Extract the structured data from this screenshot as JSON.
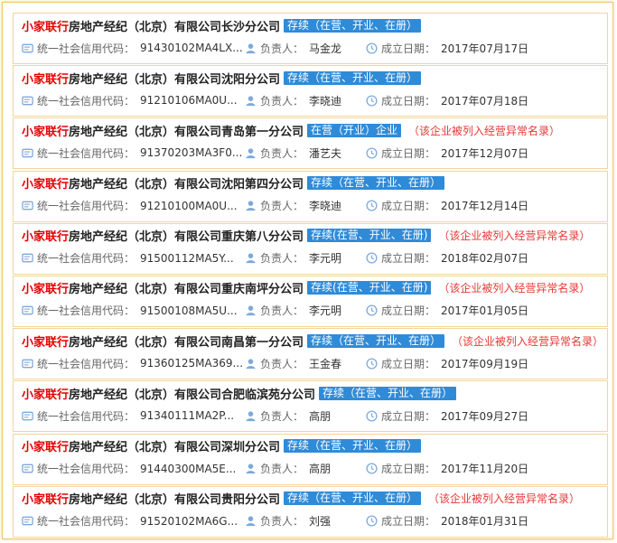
{
  "colors": {
    "brand": "#e60000",
    "status_bg": "#2f8bd8",
    "warning": "#e53935",
    "border": "#f1d59c",
    "icon": "#7fa9db"
  },
  "labels": {
    "credit": "统一社会信用代码：",
    "person": "负责人：",
    "date": "成立日期："
  },
  "companies": [
    {
      "brand": "小家联行",
      "name": "房地产经纪（北京）有限公司长沙分公司",
      "status": "存续（在营、开业、在册）",
      "abnormal": "",
      "credit_code": "91430102MA4LX...",
      "person": "马金龙",
      "date": "2017年07月17日"
    },
    {
      "brand": "小家联行",
      "name": "房地产经纪（北京）有限公司沈阳分公司",
      "status": "存续（在营、开业、在册）",
      "abnormal": "",
      "credit_code": "91210106MA0U...",
      "person": "李晓迪",
      "date": "2017年07月18日"
    },
    {
      "brand": "小家联行",
      "name": "房地产经纪（北京）有限公司青岛第一分公司",
      "status": "在营（开业）企业",
      "abnormal": "（该企业被列入经营异常名录）",
      "credit_code": "91370203MA3F0...",
      "person": "潘艺夫",
      "date": "2017年12月07日"
    },
    {
      "brand": "小家联行",
      "name": "房地产经纪（北京）有限公司沈阳第四分公司",
      "status": "存续（在营、开业、在册）",
      "abnormal": "",
      "credit_code": "91210100MA0U...",
      "person": "李晓迪",
      "date": "2017年12月14日"
    },
    {
      "brand": "小家联行",
      "name": "房地产经纪（北京）有限公司重庆第八分公司",
      "status": "存续(在营、开业、在册)",
      "abnormal": "（该企业被列入经营异常名录）",
      "credit_code": "91500112MA5Y...",
      "person": "李元明",
      "date": "2018年02月07日"
    },
    {
      "brand": "小家联行",
      "name": "房地产经纪（北京）有限公司重庆南坪分公司",
      "status": "存续(在营、开业、在册)",
      "abnormal": "（该企业被列入经营异常名录）",
      "credit_code": "91500108MA5U...",
      "person": "李元明",
      "date": "2017年01月05日"
    },
    {
      "brand": "小家联行",
      "name": "房地产经纪（北京）有限公司南昌第一分公司",
      "status": "存续（在营、开业、在册）",
      "abnormal": "（该企业被列入经营异常名录）",
      "credit_code": "91360125MA369...",
      "person": "王金春",
      "date": "2017年09月19日"
    },
    {
      "brand": "小家联行",
      "name": "房地产经纪（北京）有限公司合肥临滨苑分公司",
      "status": "存续（在营、开业、在册）",
      "abnormal": "",
      "credit_code": "91340111MA2P...",
      "person": "高朋",
      "date": "2017年09月27日"
    },
    {
      "brand": "小家联行",
      "name": "房地产经纪（北京）有限公司深圳分公司",
      "status": "存续（在营、开业、在册）",
      "abnormal": "",
      "credit_code": "91440300MA5E...",
      "person": "高朋",
      "date": "2017年11月20日"
    },
    {
      "brand": "小家联行",
      "name": "房地产经纪（北京）有限公司贵阳分公司",
      "status": "存续（在营、开业、在册）",
      "abnormal": "（该企业被列入经营异常名录）",
      "credit_code": "91520102MA6G...",
      "person": "刘强",
      "date": "2018年01月31日"
    }
  ]
}
